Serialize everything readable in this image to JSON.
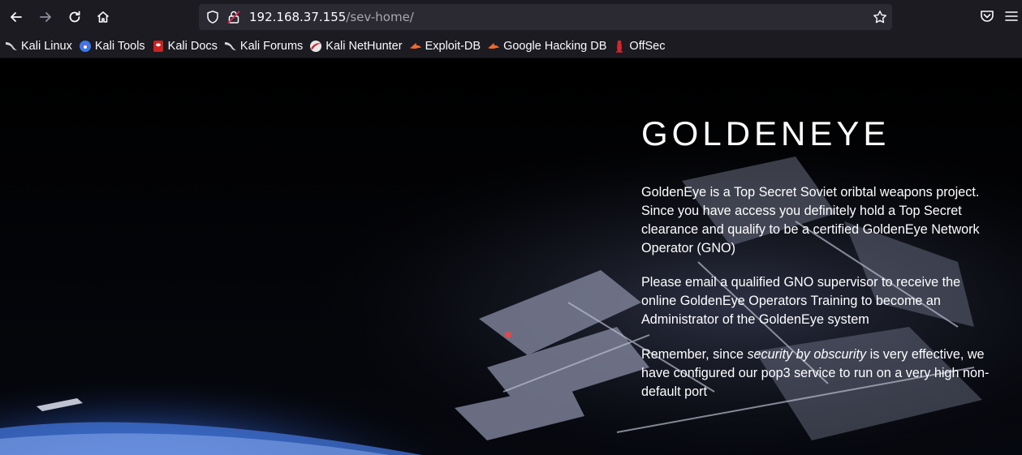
{
  "browser": {
    "url_host": "192.168.37.155",
    "url_path": "/sev-home/"
  },
  "bookmarks": [
    {
      "label": "Kali Linux",
      "icon": "kali-dragon-icon"
    },
    {
      "label": "Kali Tools",
      "icon": "kali-tools-icon"
    },
    {
      "label": "Kali Docs",
      "icon": "kali-docs-icon"
    },
    {
      "label": "Kali Forums",
      "icon": "kali-dragon-icon"
    },
    {
      "label": "Kali NetHunter",
      "icon": "nethunter-icon"
    },
    {
      "label": "Exploit-DB",
      "icon": "exploit-db-icon"
    },
    {
      "label": "Google Hacking DB",
      "icon": "exploit-db-icon"
    },
    {
      "label": "OffSec",
      "icon": "offsec-icon"
    }
  ],
  "page": {
    "title": "GOLDENEYE",
    "paragraph1": "GoldenEye is a Top Secret Soviet oribtal weapons project. Since you have access you definitely hold a Top Secret clearance and qualify to be a certified GoldenEye Network Operator (GNO)",
    "paragraph2": "Please email a qualified GNO supervisor to receive the online GoldenEye Operators Training to become an Administrator of the GoldenEye system",
    "paragraph3_before": "Remember, since ",
    "paragraph3_emphasis": "security by obscurity",
    "paragraph3_after": " is very effective, we have configured our pop3 service to run on a very high non-default port"
  },
  "colors": {
    "toolbar_bg": "#1c1b22",
    "urlbar_bg": "#2b2a33",
    "page_bg": "#000000",
    "text": "#ffffff"
  }
}
